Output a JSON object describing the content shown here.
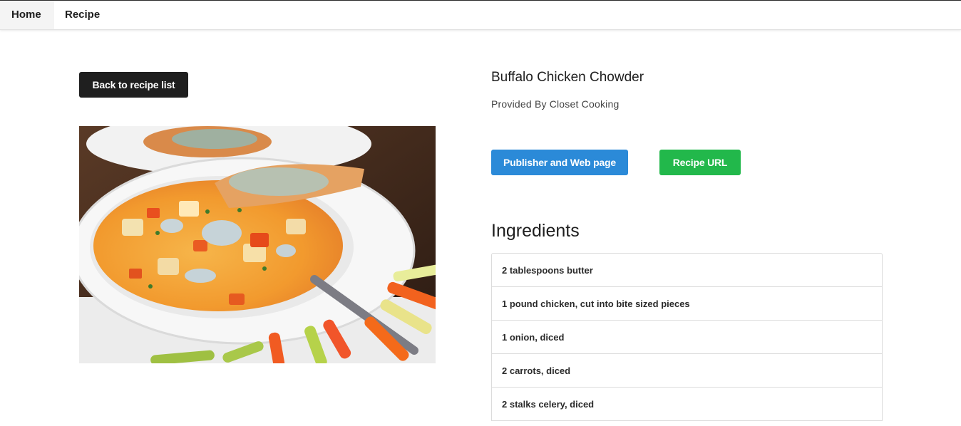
{
  "nav": {
    "home_label": "Home",
    "recipe_label": "Recipe"
  },
  "back_button_label": "Back to recipe list",
  "recipe": {
    "title": "Buffalo Chicken Chowder",
    "provider_prefix": "Provided By",
    "provider_name": "Closet Cooking"
  },
  "actions": {
    "publisher_label": "Publisher and Web page",
    "url_label": "Recipe URL"
  },
  "ingredients": {
    "heading": "Ingredients",
    "items": [
      "2 tablespoons butter",
      "1 pound chicken, cut into bite sized pieces",
      "1 onion, diced",
      "2 carrots, diced",
      "2 stalks celery, diced"
    ]
  },
  "colors": {
    "publisher_button": "#2b8ad8",
    "url_button": "#22b84b",
    "back_button": "#1f1f1f"
  }
}
